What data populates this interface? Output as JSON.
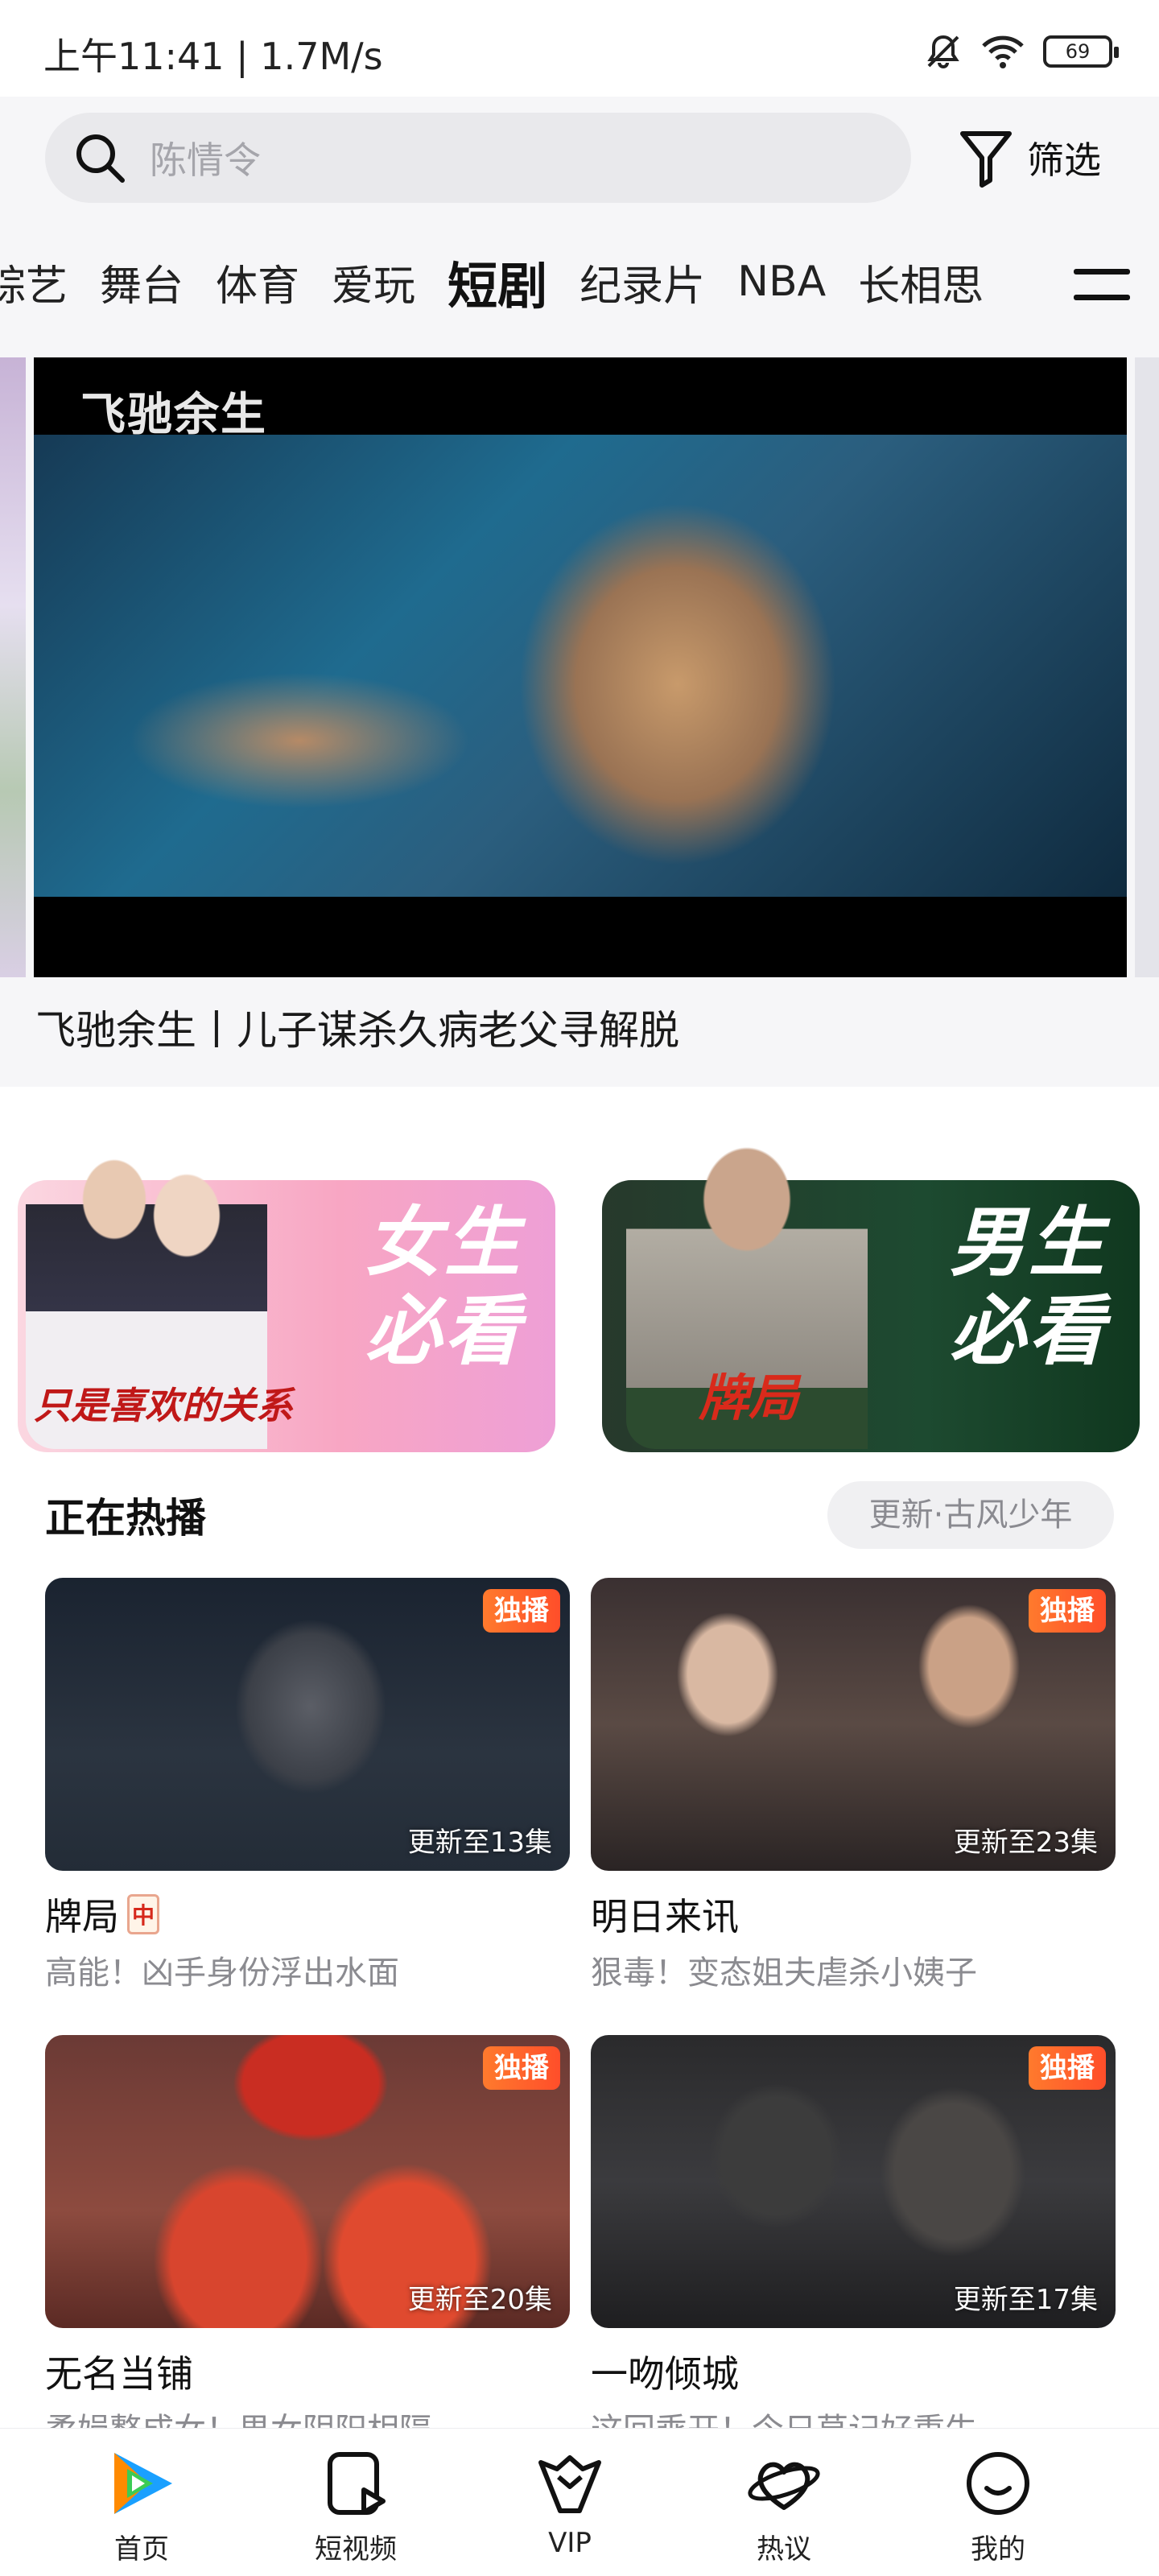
{
  "status_bar": {
    "time": "上午11:41 | 1.7M/s",
    "battery": "69"
  },
  "search": {
    "placeholder": "陈情令",
    "filter_label": "筛选"
  },
  "tabs": [
    "综艺",
    "舞台",
    "体育",
    "爱玩",
    "短剧",
    "纪录片",
    "NBA",
    "长相思"
  ],
  "active_tab": "短剧",
  "hero": {
    "logo_text": "飞驰余生",
    "caption": "飞驰余生丨儿子谋杀久病老父寻解脱"
  },
  "promos": [
    {
      "title_line1": "女生",
      "title_line2": "必看",
      "poster_text": "只是喜欢的关系"
    },
    {
      "title_line1": "男生",
      "title_line2": "必看",
      "poster_text": "牌局"
    }
  ],
  "section": {
    "title": "正在热播",
    "update_pill": "更新·古风少年"
  },
  "dramas": [
    {
      "title": "牌局",
      "desc": "高能！凶手身份浮出水面",
      "badge": "独播",
      "episodes": "更新至13集",
      "tile_glyph": "中"
    },
    {
      "title": "明日来讯",
      "desc": "狠毒！变态姐夫虐杀小姨子",
      "badge": "独播",
      "episodes": "更新至23集"
    },
    {
      "title": "无名当铺",
      "desc": "柔娟整成女！男女阴阳相隔",
      "badge": "独播",
      "episodes": "更新至20集"
    },
    {
      "title": "一吻倾城",
      "desc": "这回乘开！今日草记好重生",
      "badge": "独播",
      "episodes": "更新至17集"
    }
  ],
  "bottom_nav": [
    {
      "label": "首页",
      "icon": "tencent-video-logo-icon"
    },
    {
      "label": "短视频",
      "icon": "short-video-icon"
    },
    {
      "label": "VIP",
      "icon": "vip-crown-icon"
    },
    {
      "label": "热议",
      "icon": "planet-icon"
    },
    {
      "label": "我的",
      "icon": "smiley-face-icon"
    }
  ],
  "colors": {
    "accent": "#ff5a2c",
    "page_bg": "#f6f6f8",
    "muted_text": "#8b8b90"
  }
}
